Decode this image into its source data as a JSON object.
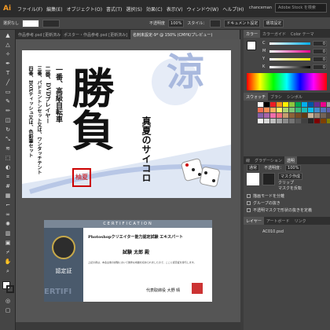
{
  "app": {
    "logo": "Ai",
    "user": "chanceman",
    "search_placeholder": "Adobe Stock を検索",
    "menus": [
      "ファイル(F)",
      "編集(E)",
      "オブジェクト(O)",
      "書式(T)",
      "選択(S)",
      "効果(C)",
      "表示(V)",
      "ウィンドウ(W)",
      "ヘルプ(H)"
    ]
  },
  "control": {
    "select_label": "選択なし",
    "style_label": "スタイル：",
    "opacity_label": "不透明度",
    "opacity_value": "100%",
    "doc_settings": "ドキュメント設定",
    "env_settings": "環境設定"
  },
  "tabs": [
    "作品参考.psd [更新済み]",
    "ポスター・作品参考.psd [更新済み]",
    "名刺未設定-9* @ 150% (CMYK/プレビュー)"
  ],
  "right_panels": {
    "color_tabs": [
      "カラー",
      "カラーガイド",
      "Color テーマ"
    ],
    "color_sliders": [
      {
        "label": "C",
        "value": "0",
        "color": "#00aeef"
      },
      {
        "label": "M",
        "value": "0",
        "color": "#ec008c"
      },
      {
        "label": "Y",
        "value": "0",
        "color": "#fff200"
      },
      {
        "label": "K",
        "value": "0",
        "color": "#555555"
      }
    ],
    "swatch_tabs": [
      "スウォッチ",
      "ブラシ",
      "シンボル"
    ],
    "swatches": [
      "#ffffff",
      "#000000",
      "#ed1c24",
      "#f7941d",
      "#fff200",
      "#8dc63f",
      "#00a651",
      "#00aeef",
      "#0054a6",
      "#662d91",
      "#ec008c",
      "#a0a0a0",
      "#f26c4f",
      "#f68e56",
      "#fbaf5d",
      "#fff568",
      "#acd373",
      "#7cc576",
      "#3bb878",
      "#1abbb4",
      "#00bff3",
      "#438ccb",
      "#5574b9",
      "#605ca8",
      "#8560a8",
      "#a763a8",
      "#f06eaa",
      "#f26d7d",
      "#c69c6e",
      "#8c6239",
      "#754c24",
      "#603913",
      "#c7b299",
      "#998675",
      "#736357",
      "#534741",
      "#f2f2f2",
      "#d9d9d9",
      "#bfbfbf",
      "#a6a6a6",
      "#8c8c8c",
      "#737373",
      "#595959",
      "#404040",
      "#262626",
      "#7f0000",
      "#7f4000",
      "#807f00"
    ],
    "appearance_tabs": [
      "線",
      "グラデーション",
      "透明"
    ],
    "blend_mode": "通常",
    "opacity_label": "不透明度：",
    "opacity_value": "100%",
    "options": [
      "描画モードを分離",
      "グループの抜き",
      "不透明マスクで形状の抜きを定義"
    ],
    "masks": [
      "マスク作成",
      "クリップ",
      "マスクを反転"
    ],
    "layers_tabs": [
      "レイヤー",
      "アートボード",
      "リンク"
    ],
    "layer_item": "AC010.psd"
  },
  "artboard1": {
    "title": "勝負",
    "sub1": "涼",
    "sub2": "真夏のサイコロ",
    "prize1": "一番、高級自転車",
    "prize2": "二番、DVDプレイヤー",
    "prize3": "三番、バドミントンセット又は、ワンタッチテント",
    "prize4": "四番、BOXティッシュ又は、色鉛筆セット",
    "stamp": "柚夏"
  },
  "artboard2": {
    "header": "CERTIFICATION",
    "title": "Photoshopクリエイター能力認定試験 エキスパート",
    "name": "試験 太郎 殿",
    "body": "上記の者は、本会主催の試験において優秀な成績を収められましたので、ここに認定証を授与します。",
    "seal_label": "認定証",
    "badge": "ERTIFI",
    "issuer": "代表取締役 大野 晴"
  }
}
